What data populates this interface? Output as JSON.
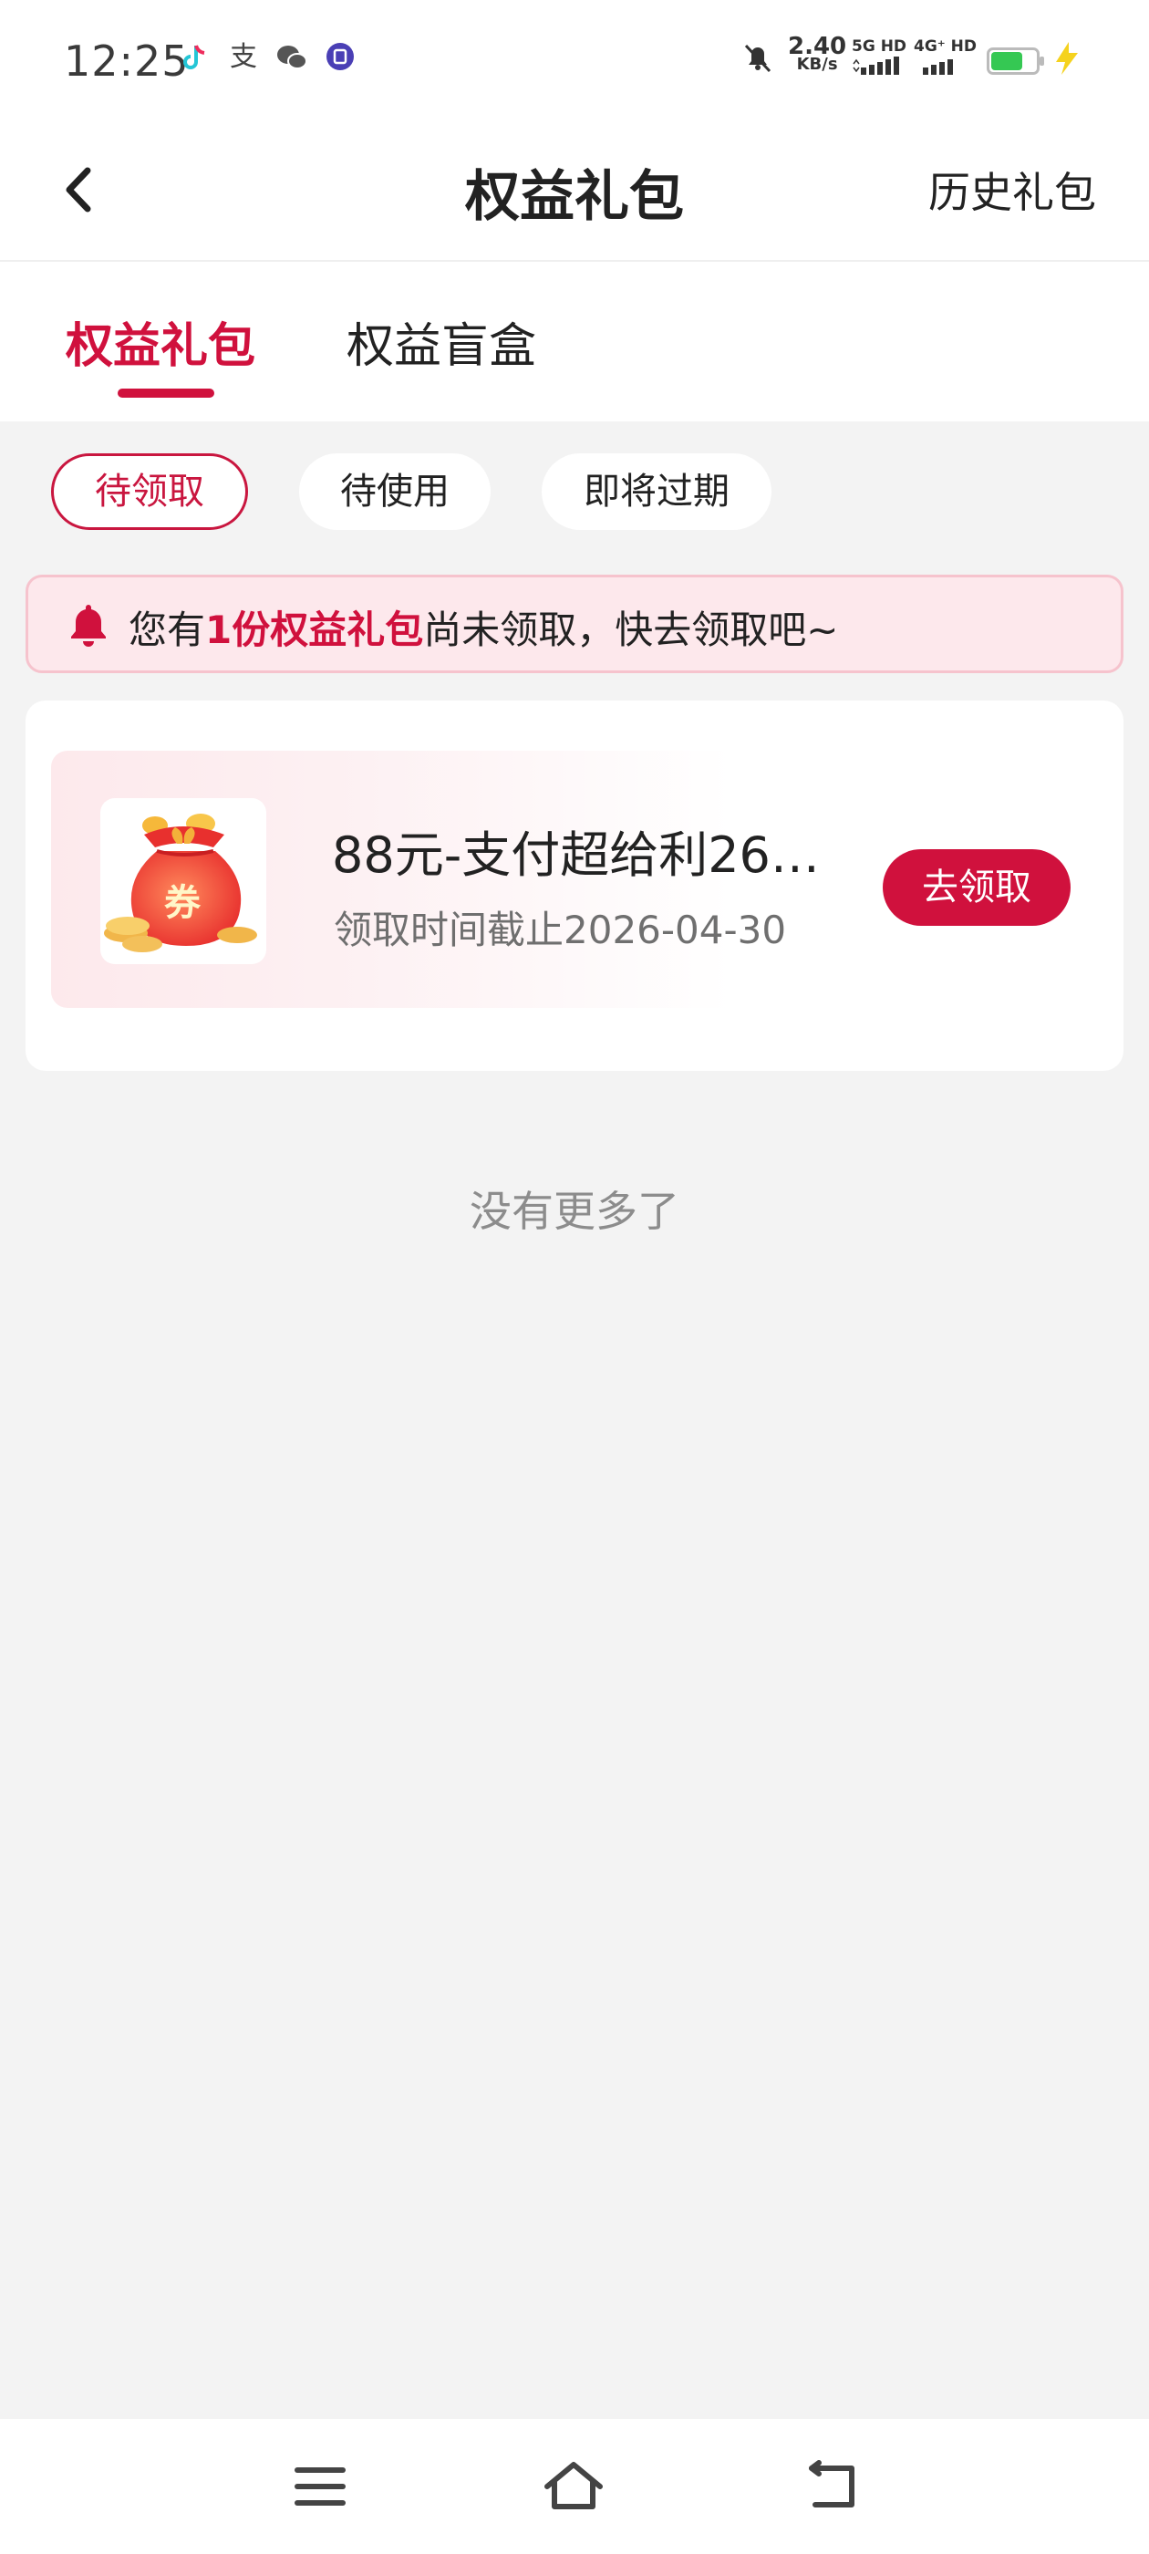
{
  "status_bar": {
    "time": "12:25",
    "apps": [
      "tiktok-icon",
      "alipay-icon",
      "wechat-icon",
      "notes-icon"
    ],
    "alipay_glyph": "支",
    "network_speed": "2.40",
    "network_unit": "KB/s",
    "sim1": "5G HD",
    "sim2": "4G⁺ HD",
    "battery_level": 0.7,
    "accent_battery": "#35c853"
  },
  "header": {
    "title": "权益礼包",
    "history_label": "历史礼包"
  },
  "tabs": [
    {
      "label": "权益礼包",
      "active": true
    },
    {
      "label": "权益盲盒",
      "active": false
    }
  ],
  "filters": [
    {
      "label": "待领取",
      "selected": true
    },
    {
      "label": "待使用",
      "selected": false
    },
    {
      "label": "即将过期",
      "selected": false
    }
  ],
  "notice": {
    "prefix": "您有",
    "highlight": "1份权益礼包",
    "suffix": "尚未领取，快去领取吧~"
  },
  "items": [
    {
      "title": "88元-支付超给利26…",
      "deadline": "领取时间截止2026-04-30",
      "button_label": "去领取",
      "badge_text": "券"
    }
  ],
  "footer_text": "没有更多了",
  "theme": {
    "accent": "#d0113d",
    "background": "#f3f3f3"
  }
}
